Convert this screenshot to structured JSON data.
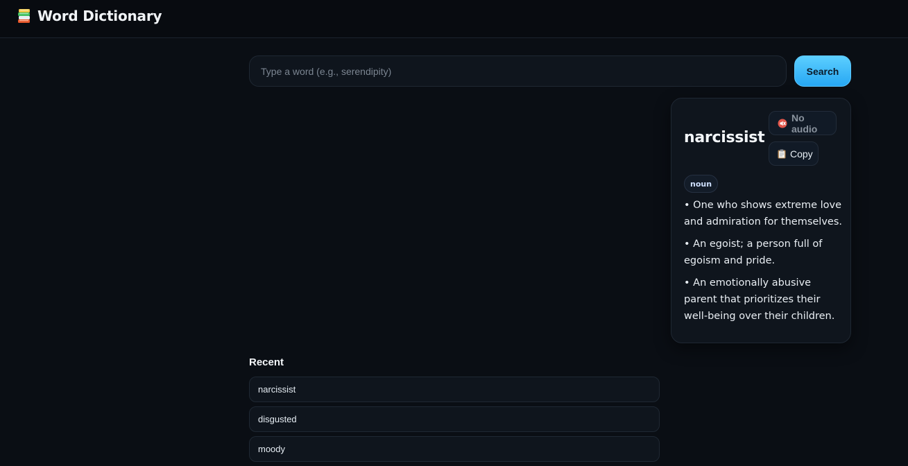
{
  "app": {
    "title": "Word Dictionary",
    "icon": "books-icon"
  },
  "search": {
    "placeholder": "Type a word (e.g., serendipity)",
    "value": "",
    "button_label": "Search"
  },
  "result": {
    "word": "narcissist",
    "audio_label": "No audio",
    "audio_icon": "muted-speaker-icon",
    "copy_label": "Copy",
    "copy_icon": "clipboard-icon",
    "part_of_speech": "noun",
    "definitions": [
      "• One who shows extreme love and admiration for themselves.",
      "• An egoist; a person full of egoism and pride.",
      "• An emotionally abusive parent that prioritizes their well-being over their children."
    ]
  },
  "recent": {
    "heading": "Recent",
    "items": [
      "narcissist",
      "disgusted",
      "moody"
    ]
  },
  "colors": {
    "background": "#0a0e14",
    "accent": "#27a7f3",
    "card": "#0f151d"
  }
}
